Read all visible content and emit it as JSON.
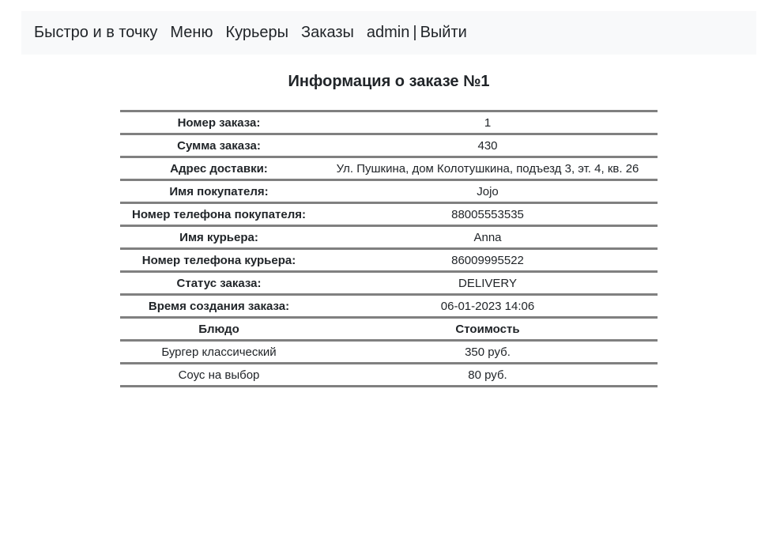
{
  "nav": {
    "brand": "Быстро и в точку",
    "menu": "Меню",
    "couriers": "Курьеры",
    "orders": "Заказы",
    "user": "admin",
    "separator": "|",
    "logout": "Выйти"
  },
  "page": {
    "title": "Информация о заказе №1"
  },
  "order": {
    "rows": [
      {
        "label": "Номер заказа:",
        "value": "1"
      },
      {
        "label": "Сумма заказа:",
        "value": "430"
      },
      {
        "label": "Адрес доставки:",
        "value": "Ул. Пушкина, дом Колотушкина, подъезд 3, эт. 4, кв. 26"
      },
      {
        "label": "Имя покупателя:",
        "value": "Jojo"
      },
      {
        "label": "Номер телефона покупателя:",
        "value": "88005553535"
      },
      {
        "label": "Имя курьера:",
        "value": "Anna"
      },
      {
        "label": "Номер телефона курьера:",
        "value": "86009995522"
      },
      {
        "label": "Статус заказа:",
        "value": "DELIVERY"
      },
      {
        "label": "Время создания заказа:",
        "value": "06-01-2023 14:06"
      }
    ],
    "items_header": {
      "dish": "Блюдо",
      "cost": "Стоимость"
    },
    "items": [
      {
        "dish": "Бургер классический",
        "cost": "350 руб."
      },
      {
        "dish": "Соус на выбор",
        "cost": "80 руб."
      }
    ]
  }
}
